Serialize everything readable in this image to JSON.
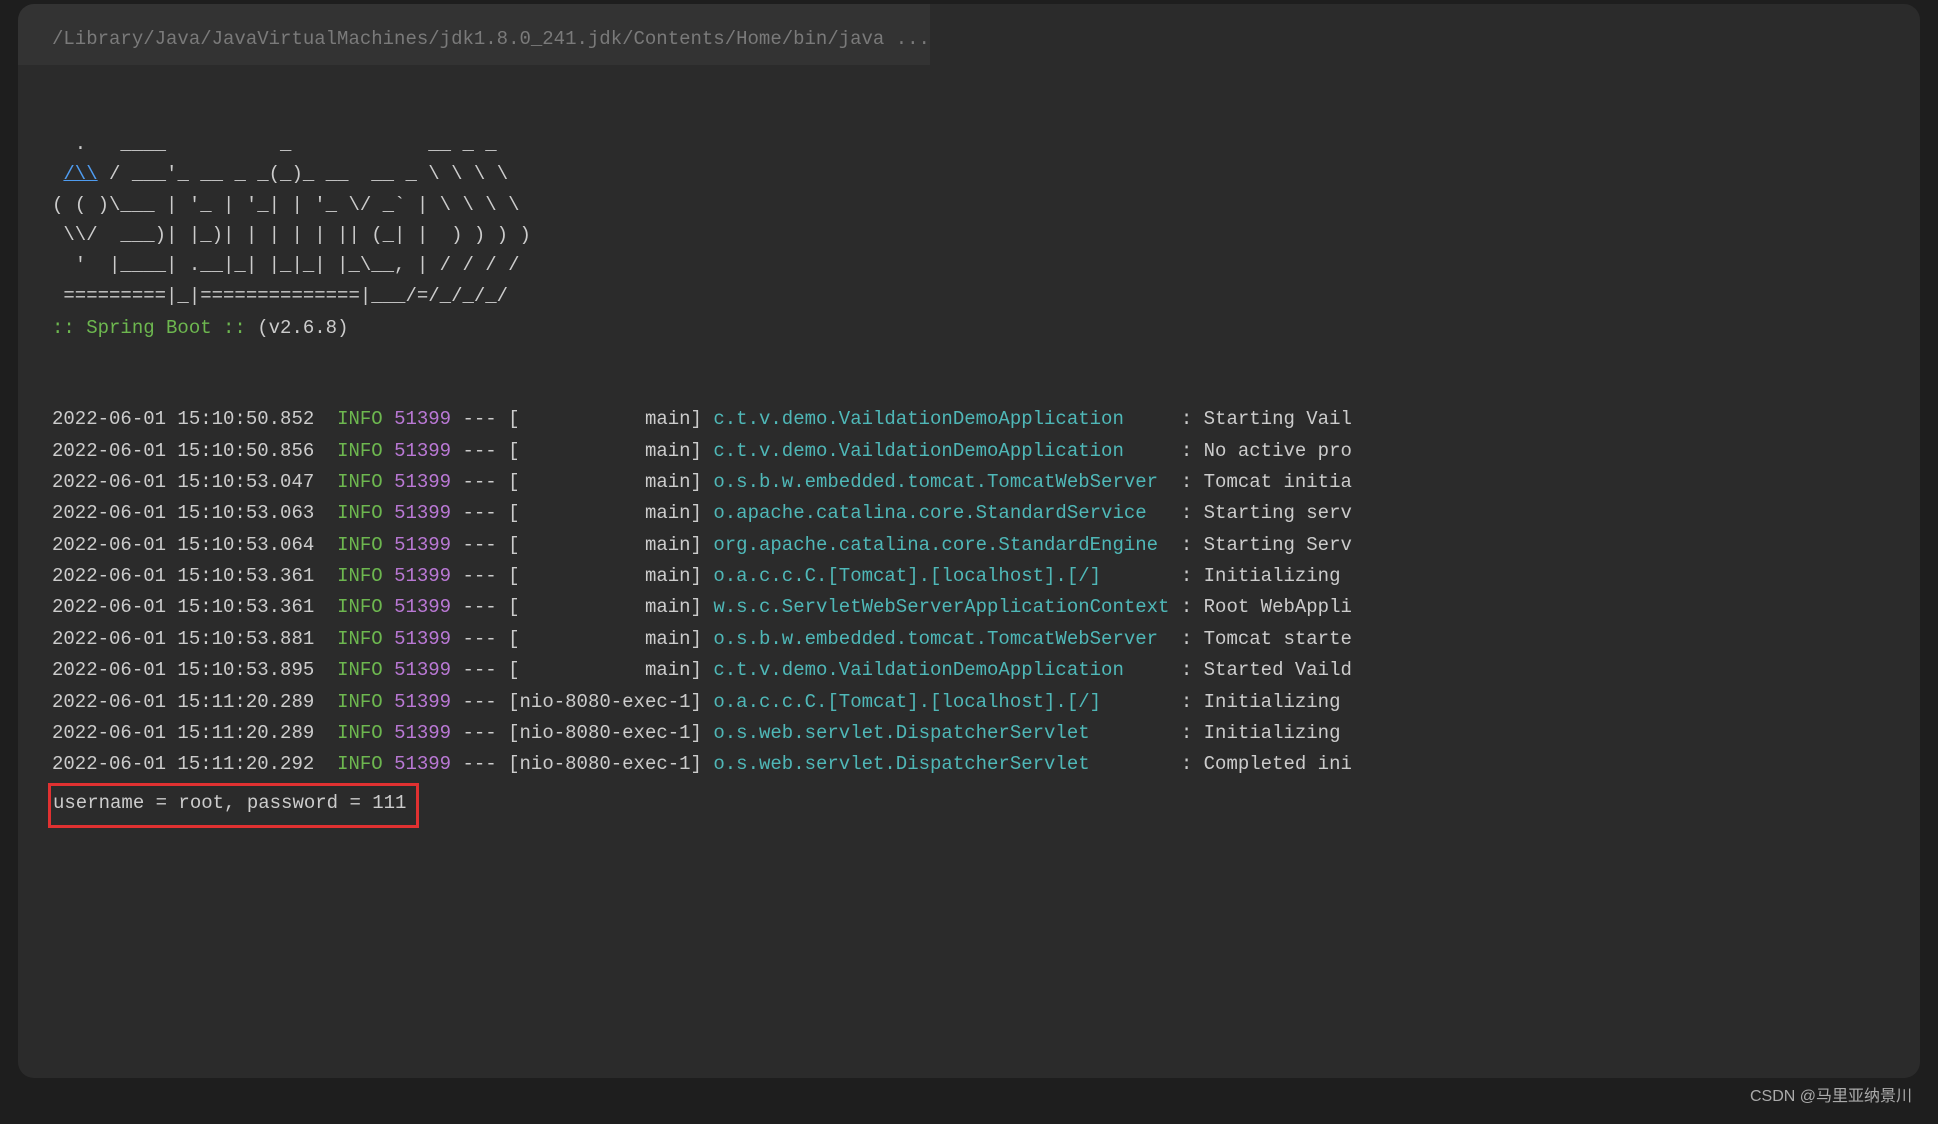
{
  "header": {
    "path": "/Library/Java/JavaVirtualMachines/jdk1.8.0_241.jdk/Contents/Home/bin/java ..."
  },
  "asciiArt": {
    "line1": "  .   ____          _            __ _ _",
    "line2a": " ",
    "linkText": "/\\\\",
    "line2b": " / ___'_ __ _ _(_)_ __  __ _ \\ \\ \\ \\",
    "line3": "( ( )\\___ | '_ | '_| | '_ \\/ _` | \\ \\ \\ \\",
    "line4": " \\\\/  ___)| |_)| | | | | || (_| |  ) ) ) )",
    "line5": "  '  |____| .__|_| |_|_| |_\\__, | / / / /",
    "line6": " =========|_|==============|___/=/_/_/_/"
  },
  "springBoot": {
    "label": " :: Spring Boot ::",
    "spacer": "                ",
    "version": "(v2.6.8)"
  },
  "logs": [
    {
      "ts": "2022-06-01 15:10:50.852",
      "level": "INFO",
      "pid": "51399",
      "thread": "[           main]",
      "logger": "c.t.v.demo.VaildationDemoApplication    ",
      "msg": " : Starting Vail"
    },
    {
      "ts": "2022-06-01 15:10:50.856",
      "level": "INFO",
      "pid": "51399",
      "thread": "[           main]",
      "logger": "c.t.v.demo.VaildationDemoApplication    ",
      "msg": " : No active pro"
    },
    {
      "ts": "2022-06-01 15:10:53.047",
      "level": "INFO",
      "pid": "51399",
      "thread": "[           main]",
      "logger": "o.s.b.w.embedded.tomcat.TomcatWebServer ",
      "msg": " : Tomcat initia"
    },
    {
      "ts": "2022-06-01 15:10:53.063",
      "level": "INFO",
      "pid": "51399",
      "thread": "[           main]",
      "logger": "o.apache.catalina.core.StandardService  ",
      "msg": " : Starting serv"
    },
    {
      "ts": "2022-06-01 15:10:53.064",
      "level": "INFO",
      "pid": "51399",
      "thread": "[           main]",
      "logger": "org.apache.catalina.core.StandardEngine ",
      "msg": " : Starting Serv"
    },
    {
      "ts": "2022-06-01 15:10:53.361",
      "level": "INFO",
      "pid": "51399",
      "thread": "[           main]",
      "logger": "o.a.c.c.C.[Tomcat].[localhost].[/]      ",
      "msg": " : Initializing "
    },
    {
      "ts": "2022-06-01 15:10:53.361",
      "level": "INFO",
      "pid": "51399",
      "thread": "[           main]",
      "logger": "w.s.c.ServletWebServerApplicationContext",
      "msg": " : Root WebAppli"
    },
    {
      "ts": "2022-06-01 15:10:53.881",
      "level": "INFO",
      "pid": "51399",
      "thread": "[           main]",
      "logger": "o.s.b.w.embedded.tomcat.TomcatWebServer ",
      "msg": " : Tomcat starte"
    },
    {
      "ts": "2022-06-01 15:10:53.895",
      "level": "INFO",
      "pid": "51399",
      "thread": "[           main]",
      "logger": "c.t.v.demo.VaildationDemoApplication    ",
      "msg": " : Started Vaild"
    },
    {
      "ts": "2022-06-01 15:11:20.289",
      "level": "INFO",
      "pid": "51399",
      "thread": "[nio-8080-exec-1]",
      "logger": "o.a.c.c.C.[Tomcat].[localhost].[/]      ",
      "msg": " : Initializing "
    },
    {
      "ts": "2022-06-01 15:11:20.289",
      "level": "INFO",
      "pid": "51399",
      "thread": "[nio-8080-exec-1]",
      "logger": "o.s.web.servlet.DispatcherServlet       ",
      "msg": " : Initializing "
    },
    {
      "ts": "2022-06-01 15:11:20.292",
      "level": "INFO",
      "pid": "51399",
      "thread": "[nio-8080-exec-1]",
      "logger": "o.s.web.servlet.DispatcherServlet       ",
      "msg": " : Completed ini"
    }
  ],
  "highlighted": {
    "text": "username = root, password = 111"
  },
  "watermark": "CSDN @马里亚纳景川"
}
